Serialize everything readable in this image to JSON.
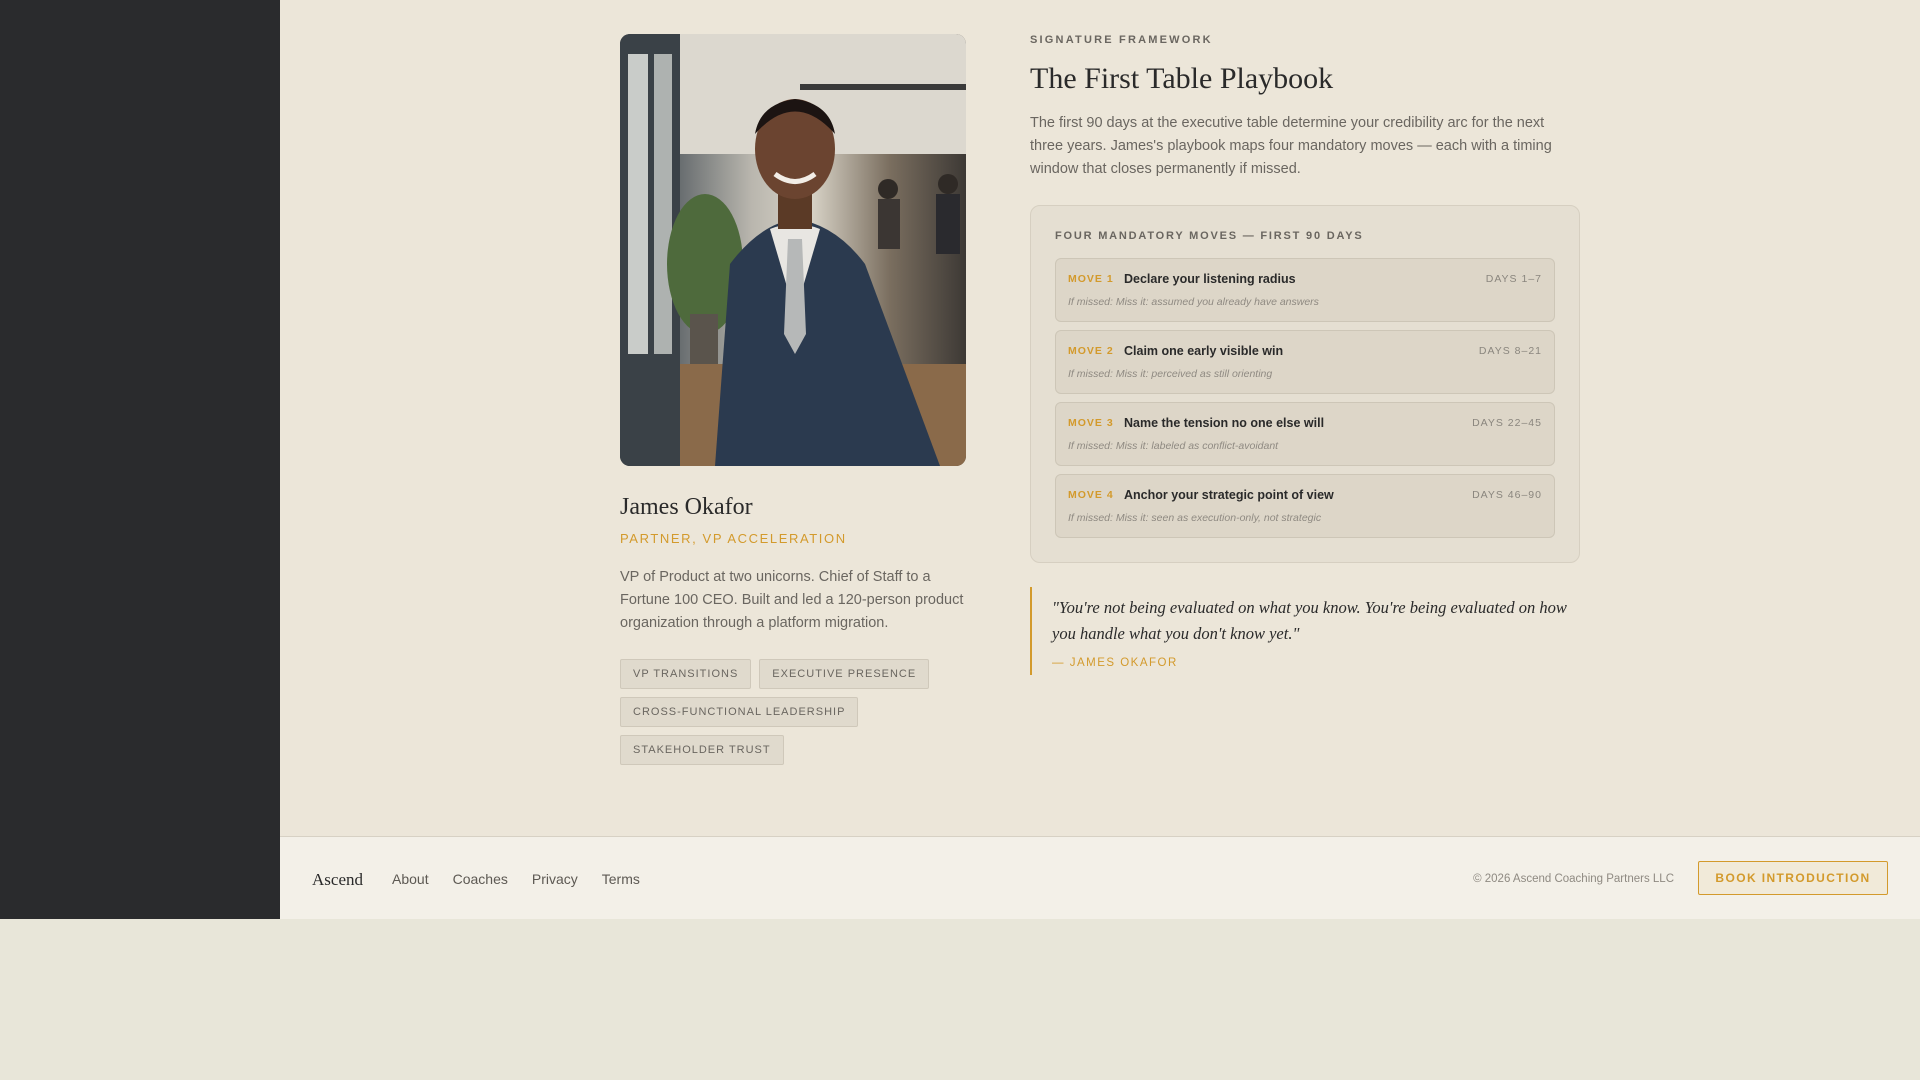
{
  "profile": {
    "name": "James Okafor",
    "role": "PARTNER, VP ACCELERATION",
    "bio": "VP of Product at two unicorns. Chief of Staff to a Fortune 100 CEO. Built and led a 120-person product organization through a platform migration.",
    "tags": [
      "VP TRANSITIONS",
      "EXECUTIVE PRESENCE",
      "CROSS-FUNCTIONAL LEADERSHIP",
      "STAKEHOLDER TRUST"
    ]
  },
  "framework": {
    "eyebrow": "SIGNATURE FRAMEWORK",
    "title": "The First Table Playbook",
    "description": "The first 90 days at the executive table determine your credibility arc for the next three years. James's playbook maps four mandatory moves — each with a timing window that closes permanently if missed.",
    "moves_heading": "FOUR MANDATORY MOVES — FIRST 90 DAYS",
    "moves": [
      {
        "num": "MOVE 1",
        "title": "Declare your listening radius",
        "days": "DAYS 1–7",
        "miss": "If missed: Miss it: assumed you already have answers"
      },
      {
        "num": "MOVE 2",
        "title": "Claim one early visible win",
        "days": "DAYS 8–21",
        "miss": "If missed: Miss it: perceived as still orienting"
      },
      {
        "num": "MOVE 3",
        "title": "Name the tension no one else will",
        "days": "DAYS 22–45",
        "miss": "If missed: Miss it: labeled as conflict-avoidant"
      },
      {
        "num": "MOVE 4",
        "title": "Anchor your strategic point of view",
        "days": "DAYS 46–90",
        "miss": "If missed: Miss it: seen as execution-only, not strategic"
      }
    ],
    "quote": "\"You're not being evaluated on what you know. You're being evaluated on how you handle what you don't know yet.\"",
    "quote_author": "— JAMES OKAFOR"
  },
  "footer": {
    "brand": "Ascend",
    "nav": [
      "About",
      "Coaches",
      "Privacy",
      "Terms"
    ],
    "copyright": "© 2026 Ascend Coaching Partners LLC",
    "cta": "BOOK INTRODUCTION"
  },
  "colors": {
    "accent": "#d39a2c",
    "sidebar": "#2a2b2d",
    "background": "#ece6d9"
  }
}
